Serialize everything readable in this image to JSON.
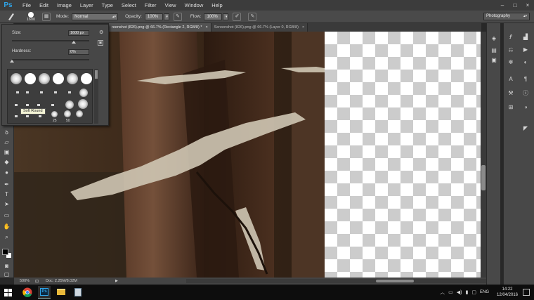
{
  "app": {
    "logo": "Ps",
    "menu": [
      "File",
      "Edit",
      "Image",
      "Layer",
      "Type",
      "Select",
      "Filter",
      "View",
      "Window",
      "Help"
    ],
    "window_controls": [
      "–",
      "□",
      "×"
    ]
  },
  "options_bar": {
    "brush_size": "1600",
    "mode_label": "Mode:",
    "mode_value": "Normal",
    "opacity_label": "Opacity:",
    "opacity_value": "100%",
    "flow_label": "Flow:",
    "flow_value": "100%",
    "workspace": "Photography"
  },
  "tabs": [
    {
      "label": "reenshot (826).png @ 66.7% (Rectangle 2, RGB/8) *",
      "close": "×",
      "active": true
    },
    {
      "label": "Screenshot (826).png @ 66.7% (Layer 0, RGB/8)",
      "close": "×",
      "active": false
    }
  ],
  "brush_picker": {
    "size_label": "Size:",
    "size_value": "1600 px",
    "size_fraction": 0.8,
    "hardness_label": "Hardness:",
    "hardness_value": "0%",
    "hardness_fraction": 0.0,
    "tooltip": "Soft Round",
    "preset_numbers": [
      "25",
      "50"
    ]
  },
  "status": {
    "zoom": "500%",
    "doc": "Doc: 2.25M/8.02M",
    "play": "▶"
  },
  "taskbar": {
    "language": "ENG",
    "time": "14:22",
    "date": "12/04/2016"
  },
  "colors": {
    "accent": "#2fa3e6",
    "foreground_swatch": "#000000",
    "background_swatch": "#ffffff"
  },
  "icons": {
    "tools": [
      "lasso-icon",
      "eraser-icon",
      "gradient-icon",
      "blur-icon",
      "dodge-icon",
      "pen-icon",
      "type-icon",
      "path-select-icon",
      "rectangle-icon",
      "hand-icon",
      "zoom-icon"
    ],
    "dock": [
      "layers-icon",
      "history-icon",
      "actions-icon",
      "adjustments-icon",
      "info-icon"
    ]
  }
}
